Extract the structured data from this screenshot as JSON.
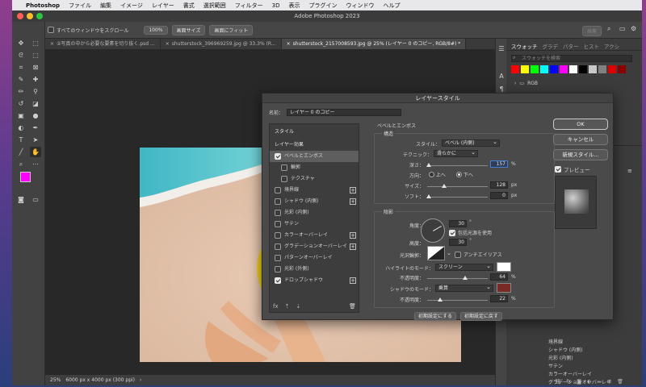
{
  "menubar": {
    "app_name": "Photoshop",
    "items": [
      "ファイル",
      "編集",
      "イメージ",
      "レイヤー",
      "書式",
      "選択範囲",
      "フィルター",
      "3D",
      "表示",
      "プラグイン",
      "ウィンドウ",
      "ヘルプ"
    ]
  },
  "window": {
    "title": "Adobe Photoshop 2023"
  },
  "options_bar": {
    "scroll_all_label": "すべてのウィンドウをスクロール",
    "zoom_100": "100%",
    "fit_screen": "画面サイズ",
    "fill_screen": "画面にフィット",
    "share_label": "共有"
  },
  "tabs": [
    {
      "label": "②写真の中から必要な要素を切り抜く.psd ..."
    },
    {
      "label": "shutterstock_396969259.jpg @ 33.3% (R..."
    },
    {
      "label": "shutterstock_2157008593.jpg @ 25% (レイヤー 0 のコピー, RGB/8#) *"
    }
  ],
  "status": {
    "zoom": "25%",
    "doc_info": "6000 px x 4000 px (300 ppi)"
  },
  "swatches_panel": {
    "tabs": [
      "スウォッチ",
      "グラデ",
      "パター",
      "ヒスト",
      "アクシ"
    ],
    "search_placeholder": "スウォッチを検索",
    "folder_label": "RGB",
    "colors": [
      "#ff0000",
      "#ffff00",
      "#00ff00",
      "#00ffff",
      "#0000ff",
      "#ff00ff",
      "#ffffff",
      "#000000",
      "#c8c8c8",
      "#808080",
      "#e00000",
      "#8a0000"
    ]
  },
  "layers_panel_visible": {
    "items": [
      "境界線",
      "シャドウ (内側)",
      "光彩 (内側)",
      "サテン",
      "カラーオーバーレイ",
      "グラデーションオーバーレイ"
    ]
  },
  "dialog": {
    "title": "レイヤースタイル",
    "name_label": "名前：",
    "name_value": "レイヤー 0 のコピー",
    "list": [
      {
        "label": "スタイル",
        "type": "hdr"
      },
      {
        "label": "レイヤー効果",
        "type": "hdr"
      },
      {
        "label": "ベベルとエンボス",
        "checked": true,
        "selected": true
      },
      {
        "label": "輪郭",
        "checked": false,
        "sub": true
      },
      {
        "label": "テクスチャ",
        "checked": false,
        "sub": true
      },
      {
        "label": "境界線",
        "checked": false,
        "plus": true
      },
      {
        "label": "シャドウ (内側)",
        "checked": false,
        "plus": true
      },
      {
        "label": "光彩 (内側)",
        "checked": false
      },
      {
        "label": "サテン",
        "checked": false
      },
      {
        "label": "カラーオーバーレイ",
        "checked": false,
        "plus": true
      },
      {
        "label": "グラデーションオーバーレイ",
        "checked": false,
        "plus": true
      },
      {
        "label": "パターンオーバーレイ",
        "checked": false
      },
      {
        "label": "光彩 (外側)",
        "checked": false
      },
      {
        "label": "ドロップシャドウ",
        "checked": true,
        "plus": true
      }
    ],
    "bevel": {
      "section_title": "ベベルとエンボス",
      "structure_title": "構造",
      "style_label": "スタイル：",
      "style_value": "ベベル (内側)",
      "technique_label": "テクニック：",
      "technique_value": "滑らかに",
      "depth_label": "深さ：",
      "depth_value": "157",
      "depth_unit": "%",
      "direction_label": "方向：",
      "direction_up": "上へ",
      "direction_down": "下へ",
      "size_label": "サイズ：",
      "size_value": "128",
      "size_unit": "px",
      "soften_label": "ソフト：",
      "soften_value": "0",
      "soften_unit": "px"
    },
    "shading": {
      "title": "陰影",
      "angle_label": "角度：",
      "angle_value": "30",
      "degree": "°",
      "global_light_label": "包括光源を使用",
      "altitude_label": "高度：",
      "altitude_value": "30",
      "gloss_label": "光沢輪郭：",
      "antialias_label": "アンチエイリアス",
      "highlight_mode_label": "ハイライトのモード：",
      "highlight_mode_value": "スクリーン",
      "highlight_color": "#ffffff",
      "highlight_opacity_label": "不透明度：",
      "highlight_opacity_value": "64",
      "shadow_mode_label": "シャドウのモード：",
      "shadow_mode_value": "乗算",
      "shadow_color": "#7a2a26",
      "shadow_opacity_label": "不透明度：",
      "shadow_opacity_value": "22",
      "percent": "%"
    },
    "make_default": "初期設定にする",
    "reset_default": "初期設定に戻す",
    "ok": "OK",
    "cancel": "キャンセル",
    "new_style": "新規スタイル...",
    "preview_label": "プレビュー",
    "fx_label": "fx"
  }
}
